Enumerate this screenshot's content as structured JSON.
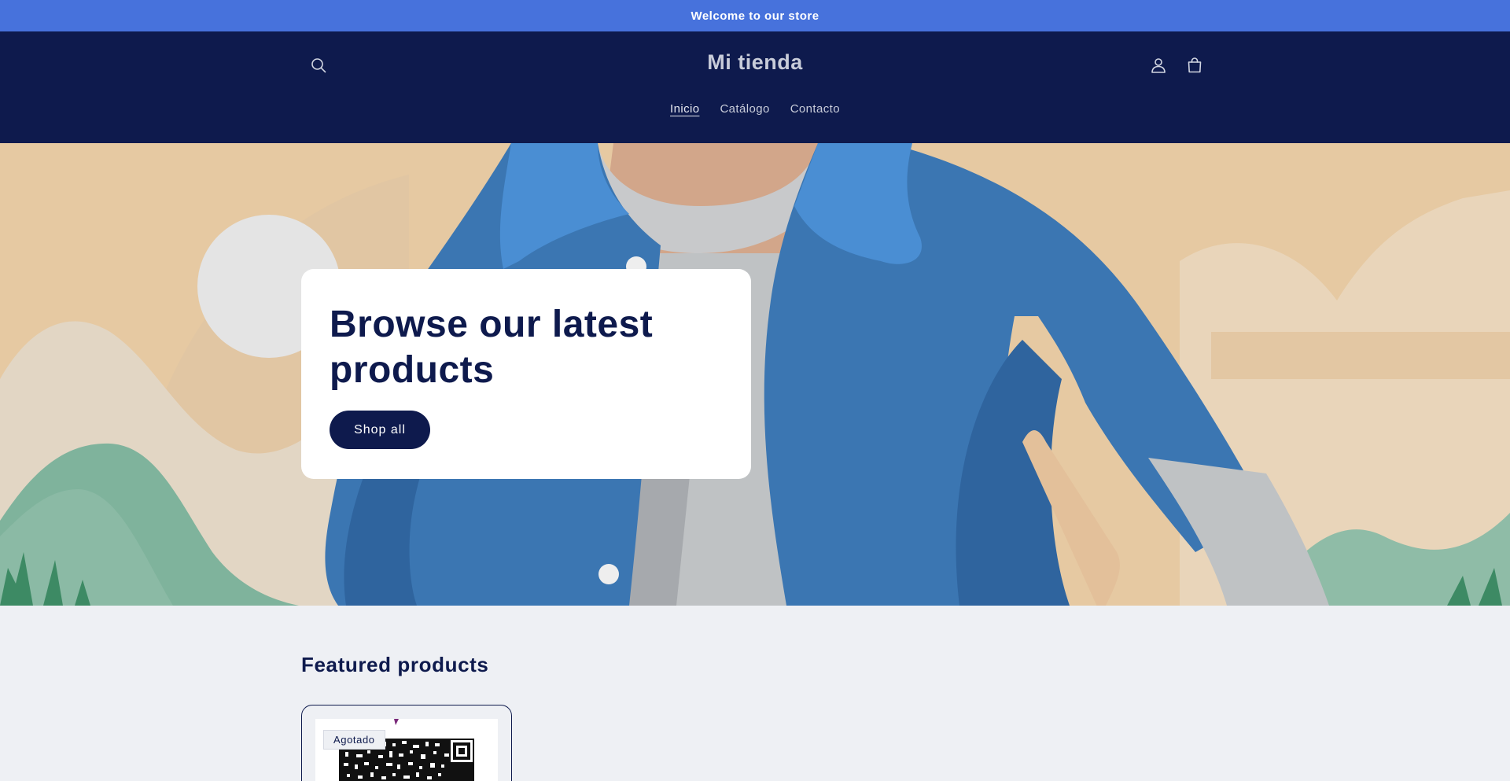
{
  "announcement": {
    "text": "Welcome to our store"
  },
  "header": {
    "logo": "Mi tienda",
    "nav": [
      {
        "label": "Inicio",
        "active": true
      },
      {
        "label": "Catálogo",
        "active": false
      },
      {
        "label": "Contacto",
        "active": false
      }
    ],
    "icons": {
      "search": "search-icon",
      "account": "user-icon",
      "cart": "cart-icon"
    }
  },
  "hero": {
    "heading": "Browse our latest products",
    "button": "Shop all"
  },
  "featured": {
    "title": "Featured products",
    "products": [
      {
        "badge": "Agotado"
      }
    ]
  },
  "colors": {
    "announcement_bg": "#4772dc",
    "header_bg": "#0e1a4d",
    "page_bg": "#eef0f4",
    "accent": "#0e1a4d"
  }
}
